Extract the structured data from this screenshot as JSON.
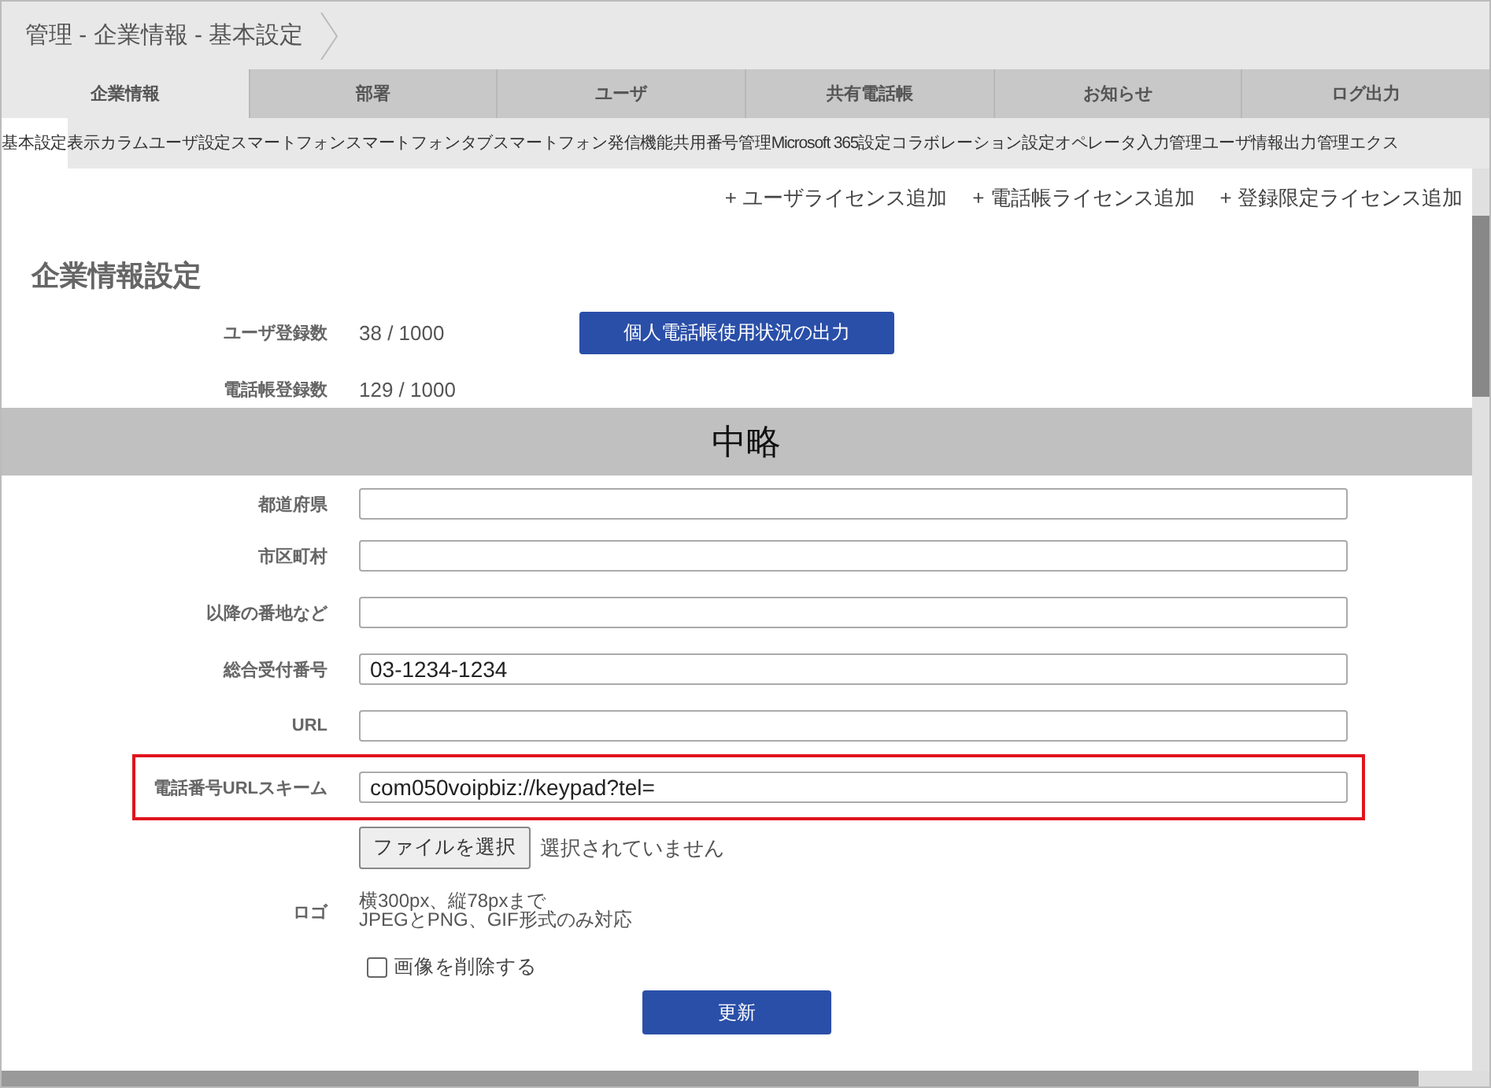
{
  "breadcrumb": "管理 - 企業情報 - 基本設定",
  "tabs": [
    {
      "label": "企業情報",
      "selected": true
    },
    {
      "label": "部署",
      "selected": false
    },
    {
      "label": "ユーザ",
      "selected": false
    },
    {
      "label": "共有電話帳",
      "selected": false
    },
    {
      "label": "お知らせ",
      "selected": false
    },
    {
      "label": "ログ出力",
      "selected": false
    }
  ],
  "subtabs": [
    {
      "label": "基本設定",
      "selected": true
    },
    {
      "label": "表示カラム",
      "selected": false
    },
    {
      "label": "ユーザ設定",
      "selected": false
    },
    {
      "label": "スマートフォン",
      "selected": false
    },
    {
      "label": "スマートフォンタブ",
      "selected": false
    },
    {
      "label": "スマートフォン発信機能",
      "selected": false
    },
    {
      "label": "共用番号管理",
      "selected": false
    },
    {
      "label": "Microsoft 365設定",
      "selected": false
    },
    {
      "label": "コラボレーション設定",
      "selected": false
    },
    {
      "label": "オペレータ入力管理",
      "selected": false
    },
    {
      "label": "ユーザ情報出力管理",
      "selected": false
    },
    {
      "label": "エクス",
      "selected": false
    }
  ],
  "actions": [
    "+ ユーザライセンス追加",
    "+ 電話帳ライセンス追加",
    "+ 登録限定ライセンス追加"
  ],
  "section_title": "企業情報設定",
  "counts": [
    {
      "label": "ユーザ登録数",
      "value": "38 / 1000",
      "button": "個人電話帳使用状況の出力"
    },
    {
      "label": "電話帳登録数",
      "value": "129 / 1000"
    }
  ],
  "omission_banner": "中略",
  "fields": [
    {
      "label": "都道府県",
      "highlighted": false
    },
    {
      "label": "市区町村",
      "highlighted": false
    },
    {
      "label": "以降の番地など",
      "highlighted": false
    },
    {
      "label": "総合受付番号",
      "value": "03-1234-1234",
      "highlighted": false
    },
    {
      "label": "URL",
      "highlighted": false
    },
    {
      "label": "電話番号URLスキーム",
      "value": "com050voipbiz://keypad?tel=",
      "highlighted": true
    }
  ],
  "logo": {
    "label": "ロゴ",
    "file_button": "ファイルを選択",
    "file_status": "選択されていません",
    "hint": [
      "横300px、縦78pxまで",
      "JPEGとPNG、GIF形式のみ対応"
    ],
    "delete_label": "画像を削除する",
    "delete_checked": false
  },
  "submit": "更新"
}
